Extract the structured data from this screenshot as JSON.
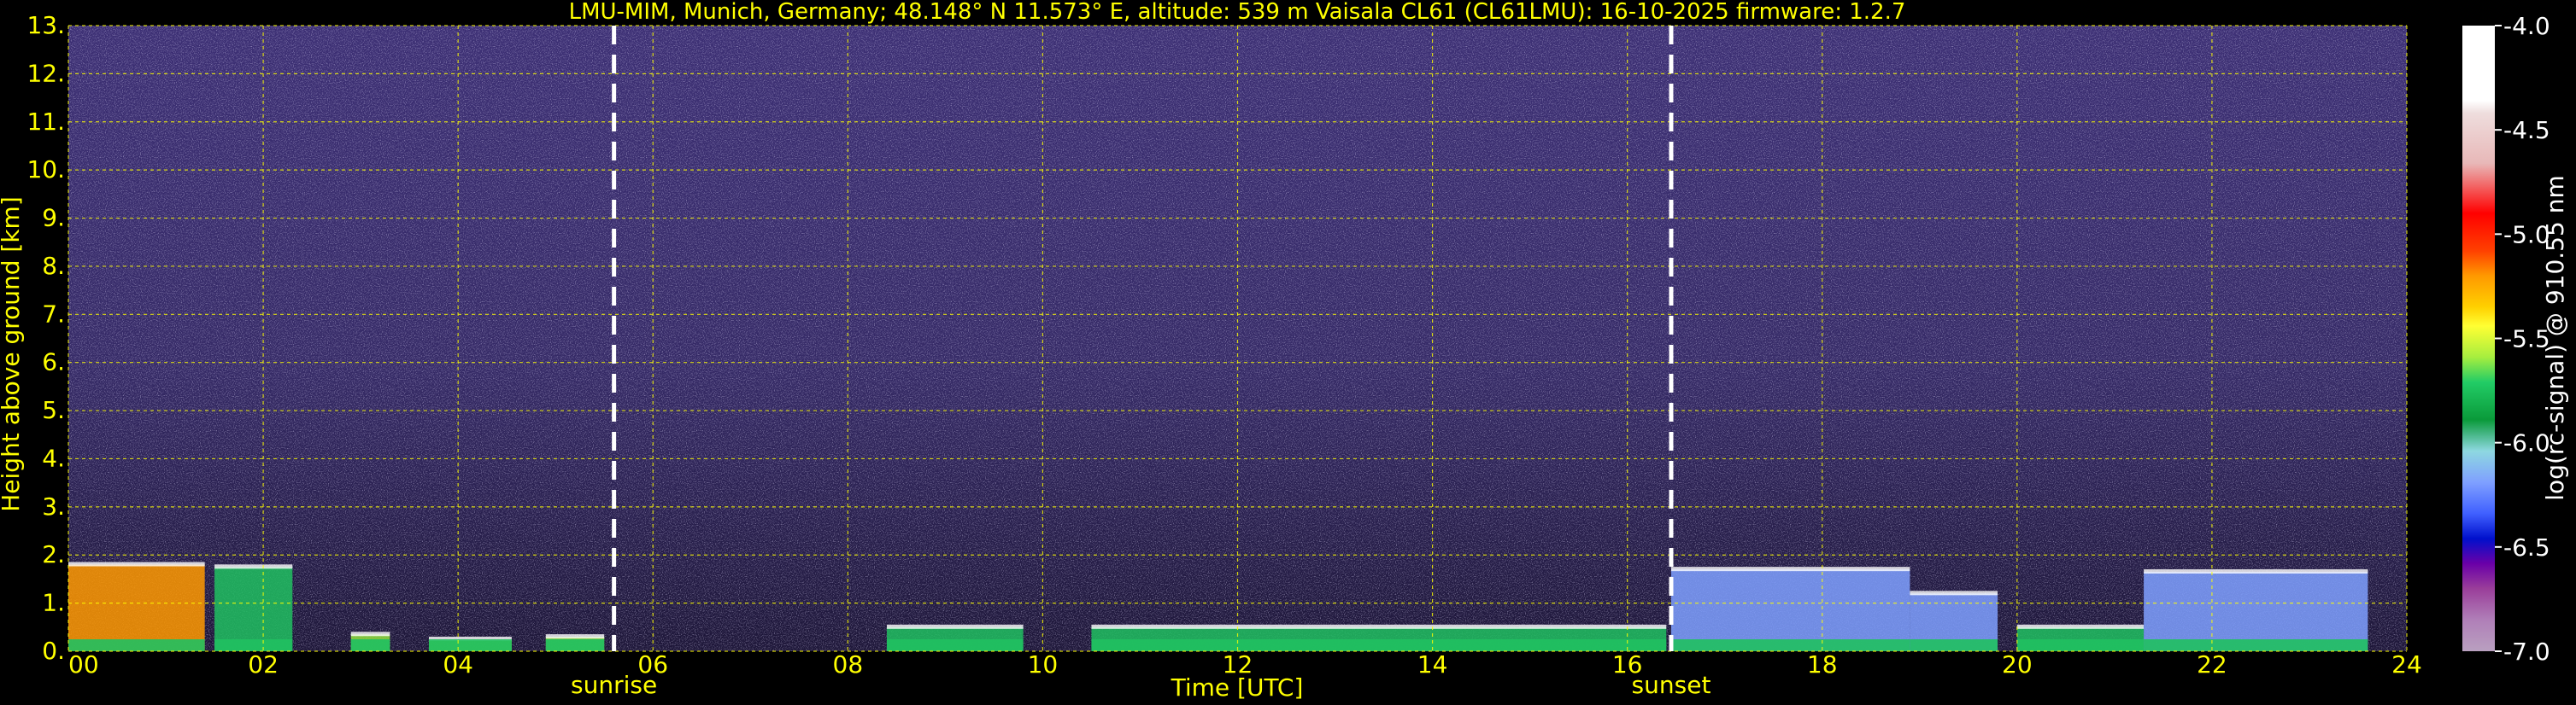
{
  "chart_data": {
    "type": "heatmap",
    "title": "LMU-MIM, Munich, Germany; 48.148° N 11.573° E, altitude: 539 m    Vaisala CL61 (CL61LMU): 16-10-2025    firmware: 1.2.7",
    "xlabel": "Time [UTC]",
    "ylabel": "Height above ground [km]",
    "xlim": [
      0,
      24
    ],
    "ylim": [
      0,
      13
    ],
    "x_ticks": [
      "00",
      "02",
      "04",
      "06",
      "08",
      "10",
      "12",
      "14",
      "16",
      "18",
      "20",
      "22",
      "24"
    ],
    "y_ticks": [
      "0.",
      "1.",
      "2.",
      "3.",
      "4.",
      "5.",
      "6.",
      "7.",
      "8.",
      "9.",
      "10.",
      "11.",
      "12.",
      "13."
    ],
    "grid": true,
    "annotations": [
      {
        "label": "sunrise",
        "x": 5.6
      },
      {
        "label": "sunset",
        "x": 16.45
      }
    ],
    "colorbar": {
      "label": "log(rc-signal) @ 910.55 nm",
      "range": [
        -7.0,
        -4.0
      ],
      "ticks": [
        "-4.0",
        "-4.5",
        "-5.0",
        "-5.5",
        "-6.0",
        "-6.5",
        "-7.0"
      ]
    },
    "boundary_layer_segments": [
      {
        "x0": 0.0,
        "x1": 1.4,
        "top": 1.8,
        "level": -5.2
      },
      {
        "x0": 1.5,
        "x1": 2.3,
        "top": 1.75,
        "level": -5.6
      },
      {
        "x0": 2.9,
        "x1": 3.3,
        "top": 0.35,
        "level": -5.4
      },
      {
        "x0": 3.7,
        "x1": 4.55,
        "top": 0.25,
        "level": -5.4
      },
      {
        "x0": 4.9,
        "x1": 5.5,
        "top": 0.3,
        "level": -5.4
      },
      {
        "x0": 8.4,
        "x1": 9.8,
        "top": 0.5,
        "level": -5.6
      },
      {
        "x0": 10.5,
        "x1": 16.4,
        "top": 0.5,
        "level": -5.7
      },
      {
        "x0": 16.45,
        "x1": 18.9,
        "top": 1.7,
        "level": -5.8
      },
      {
        "x0": 18.9,
        "x1": 19.8,
        "top": 1.2,
        "level": -5.9
      },
      {
        "x0": 20.0,
        "x1": 21.3,
        "top": 0.5,
        "level": -5.6
      },
      {
        "x0": 21.3,
        "x1": 23.6,
        "top": 1.65,
        "level": -5.9
      }
    ]
  },
  "colors": {
    "text": "#ffff00",
    "grid": "#ffff00",
    "background_noise": "#3a2d6e",
    "dashed_markers": "#ffffff"
  }
}
